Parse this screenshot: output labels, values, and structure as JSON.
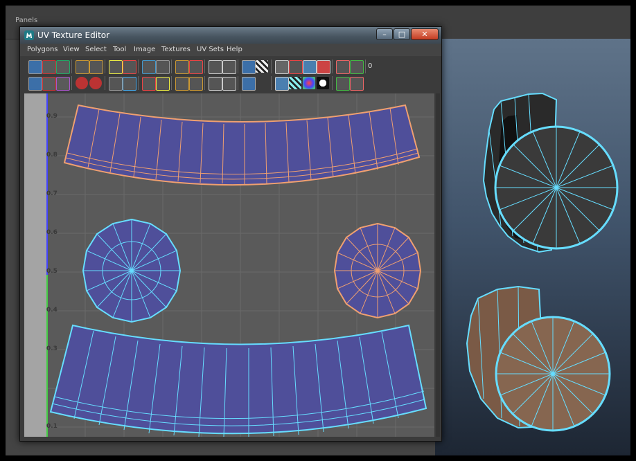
{
  "panels_bar": {
    "label": "Panels"
  },
  "uv_window": {
    "title": "UV Texture Editor",
    "buttons": {
      "minimize": "–",
      "maximize": "□",
      "close": "✕"
    },
    "menus": [
      "Polygons",
      "View",
      "Select",
      "Tool",
      "Image",
      "Textures",
      "UV Sets",
      "Help"
    ],
    "toolbar_partial_label": "0",
    "v_tick_labels": [
      "0.9",
      "0.8",
      "0.7",
      "0.6",
      "0.5",
      "0.4",
      "0.3",
      "0.1"
    ]
  },
  "colors": {
    "uv_fill": "#4f4f9a",
    "uv_edge_selected": "#66ddff",
    "uv_edge_orange": "#f0a070",
    "grid_bg": "#5a5a5a",
    "udim_strip": "#a4a4a4"
  },
  "icons": [
    "select-uv-icon",
    "move-uv-icon",
    "scale-uv-icon",
    "rotate-cw-icon",
    "rotate-ccw-icon",
    "flip-u-icon",
    "flip-v-icon",
    "align-icon",
    "grid-snap-icon",
    "cut-uv-icon",
    "sew-uv-icon",
    "unfold-icon",
    "layout-icon",
    "checker-icon",
    "display-image-icon",
    "shaded-uv-icon",
    "magnet-icon",
    "copy-icon",
    "paste-icon",
    "texture-borders-icon",
    "distortion-icon",
    "pin-icon"
  ]
}
